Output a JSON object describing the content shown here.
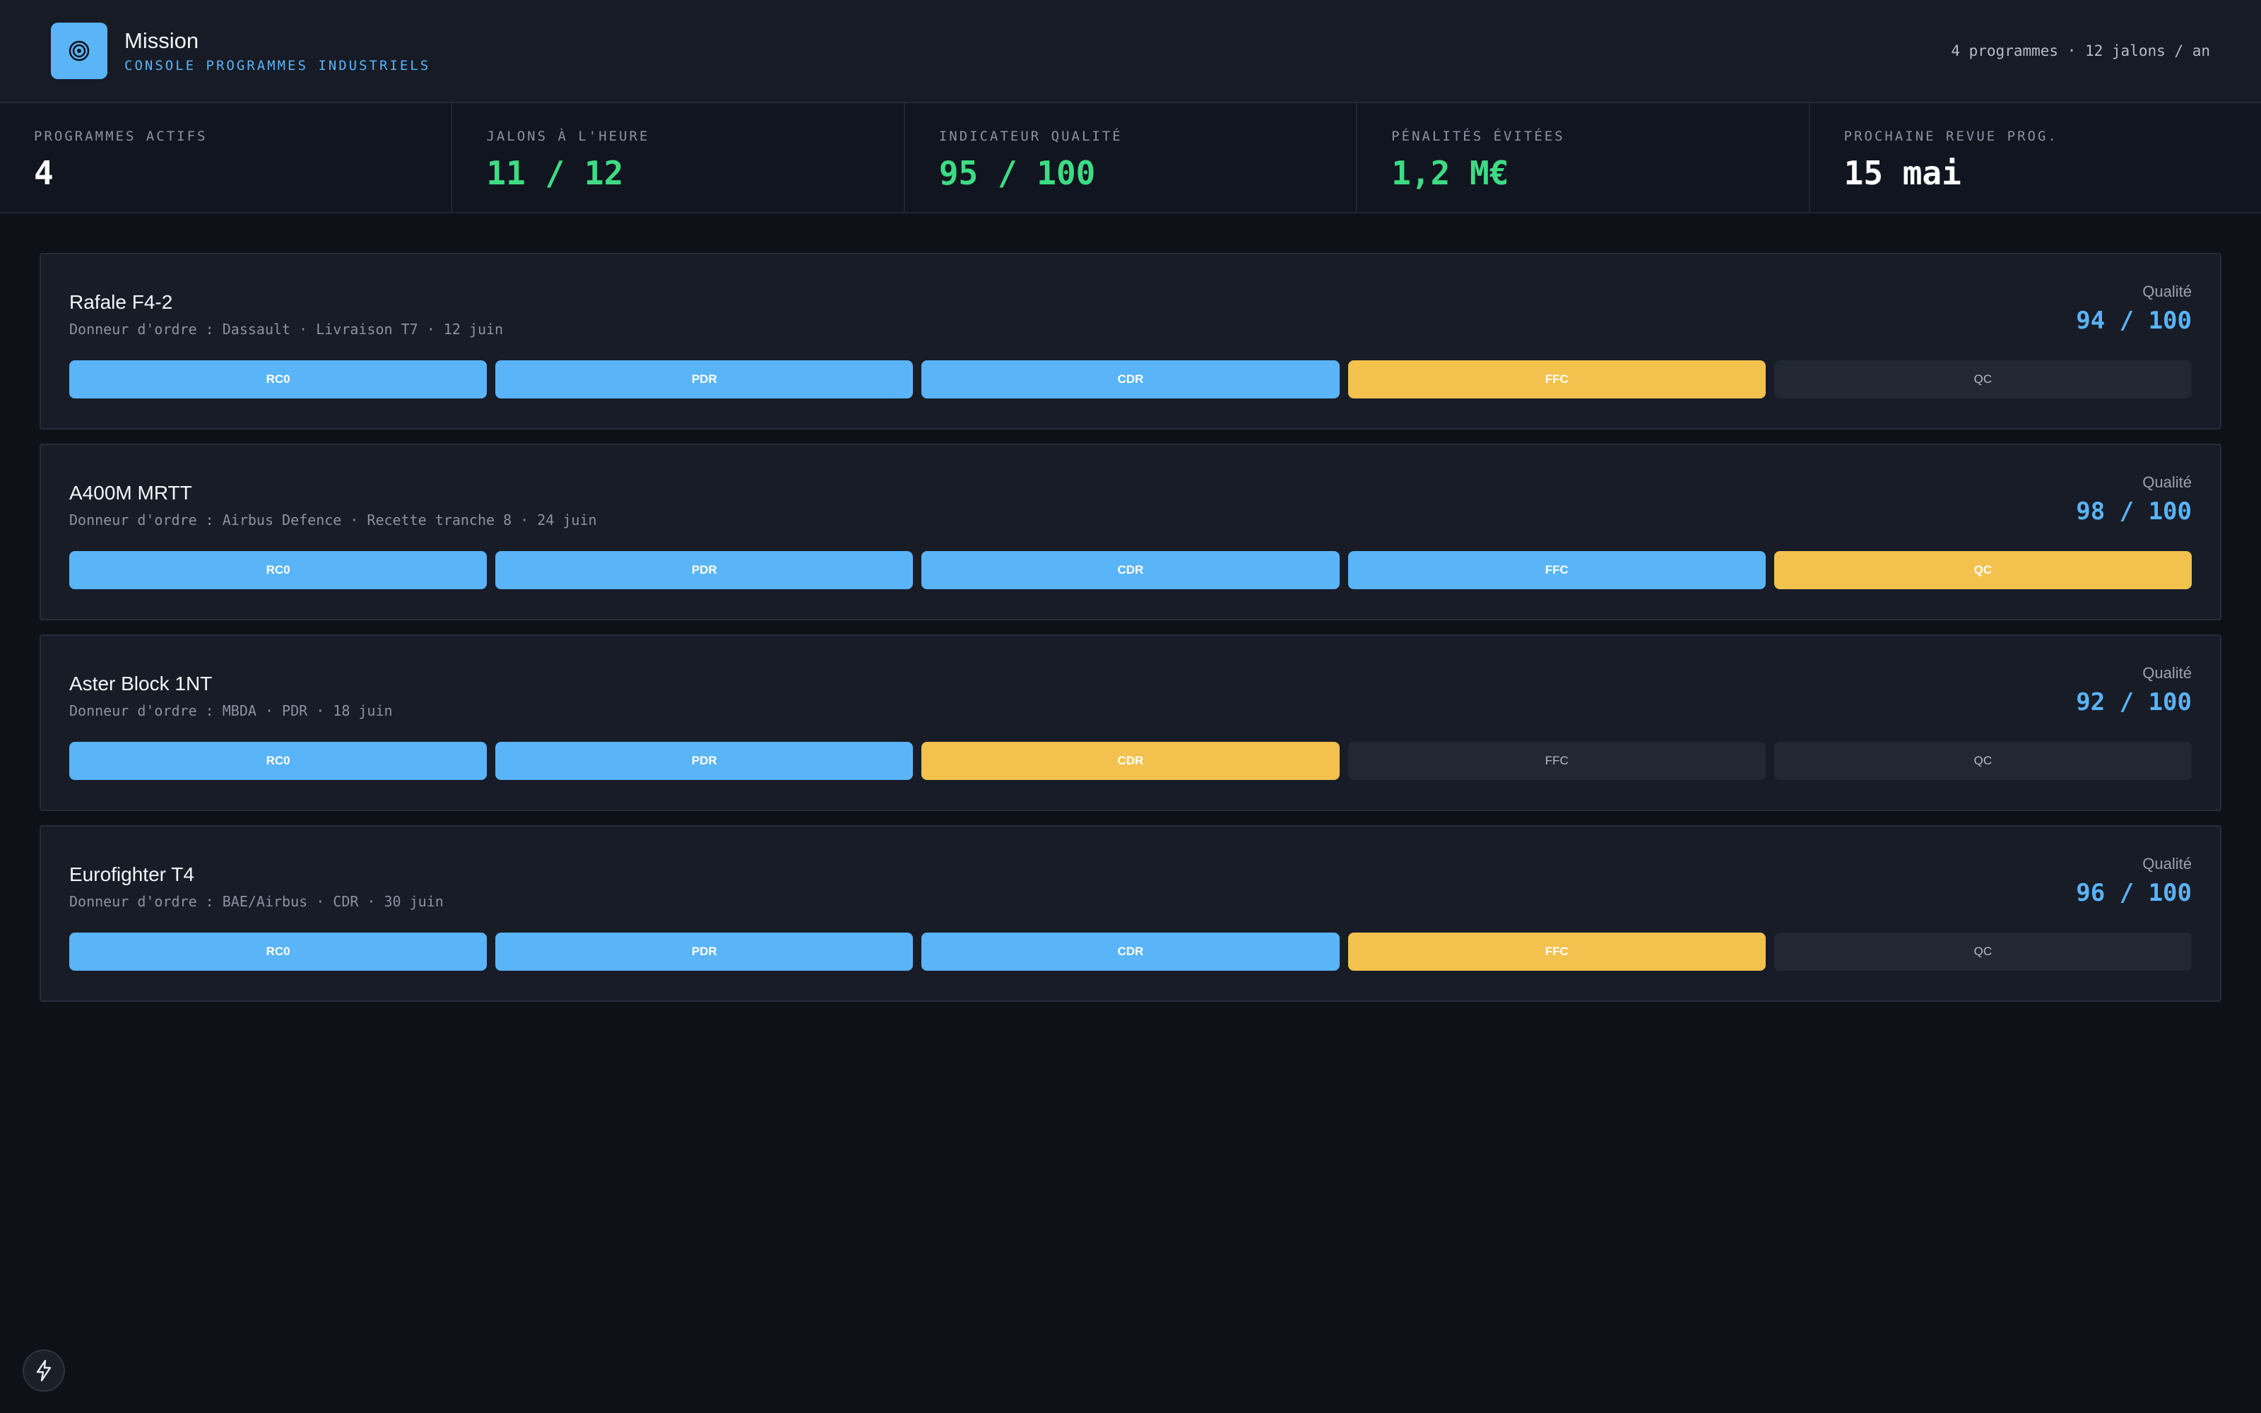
{
  "header": {
    "title": "Mission",
    "subtitle": "CONSOLE PROGRAMMES INDUSTRIELS",
    "meta": "4 programmes · 12 jalons / an",
    "logo_icon": "target-icon",
    "accent": "#5ab4f8"
  },
  "kpis": [
    {
      "label": "PROGRAMMES ACTIFS",
      "value": "4",
      "color": "white"
    },
    {
      "label": "JALONS À L'HEURE",
      "value": "11 / 12",
      "color": "green"
    },
    {
      "label": "INDICATEUR QUALITÉ",
      "value": "95 / 100",
      "color": "green"
    },
    {
      "label": "PÉNALITÉS ÉVITÉES",
      "value": "1,2 M€",
      "color": "green"
    },
    {
      "label": "PROCHAINE REVUE PROG.",
      "value": "15 mai",
      "color": "white"
    }
  ],
  "quality_label": "Qualité",
  "programs": [
    {
      "name": "Rafale F4-2",
      "subtitle": "Donneur d'ordre : Dassault · Livraison T7 · 12 juin",
      "quality": "94 / 100",
      "milestones": [
        {
          "label": "RC0",
          "state": "done"
        },
        {
          "label": "PDR",
          "state": "done"
        },
        {
          "label": "CDR",
          "state": "done"
        },
        {
          "label": "FFC",
          "state": "current"
        },
        {
          "label": "QC",
          "state": "todo"
        }
      ]
    },
    {
      "name": "A400M MRTT",
      "subtitle": "Donneur d'ordre : Airbus Defence · Recette tranche 8 · 24 juin",
      "quality": "98 / 100",
      "milestones": [
        {
          "label": "RC0",
          "state": "done"
        },
        {
          "label": "PDR",
          "state": "done"
        },
        {
          "label": "CDR",
          "state": "done"
        },
        {
          "label": "FFC",
          "state": "done"
        },
        {
          "label": "QC",
          "state": "current"
        }
      ]
    },
    {
      "name": "Aster Block 1NT",
      "subtitle": "Donneur d'ordre : MBDA · PDR · 18 juin",
      "quality": "92 / 100",
      "milestones": [
        {
          "label": "RC0",
          "state": "done"
        },
        {
          "label": "PDR",
          "state": "done"
        },
        {
          "label": "CDR",
          "state": "current"
        },
        {
          "label": "FFC",
          "state": "todo"
        },
        {
          "label": "QC",
          "state": "todo"
        }
      ]
    },
    {
      "name": "Eurofighter T4",
      "subtitle": "Donneur d'ordre : BAE/Airbus · CDR · 30 juin",
      "quality": "96 / 100",
      "milestones": [
        {
          "label": "RC0",
          "state": "done"
        },
        {
          "label": "PDR",
          "state": "done"
        },
        {
          "label": "CDR",
          "state": "done"
        },
        {
          "label": "FFC",
          "state": "current"
        },
        {
          "label": "QC",
          "state": "todo"
        }
      ]
    }
  ],
  "status_colors": {
    "done": "#5ab4f8",
    "current": "#f2c14e",
    "todo": "#222833"
  },
  "fab_icon": "lightning-icon"
}
